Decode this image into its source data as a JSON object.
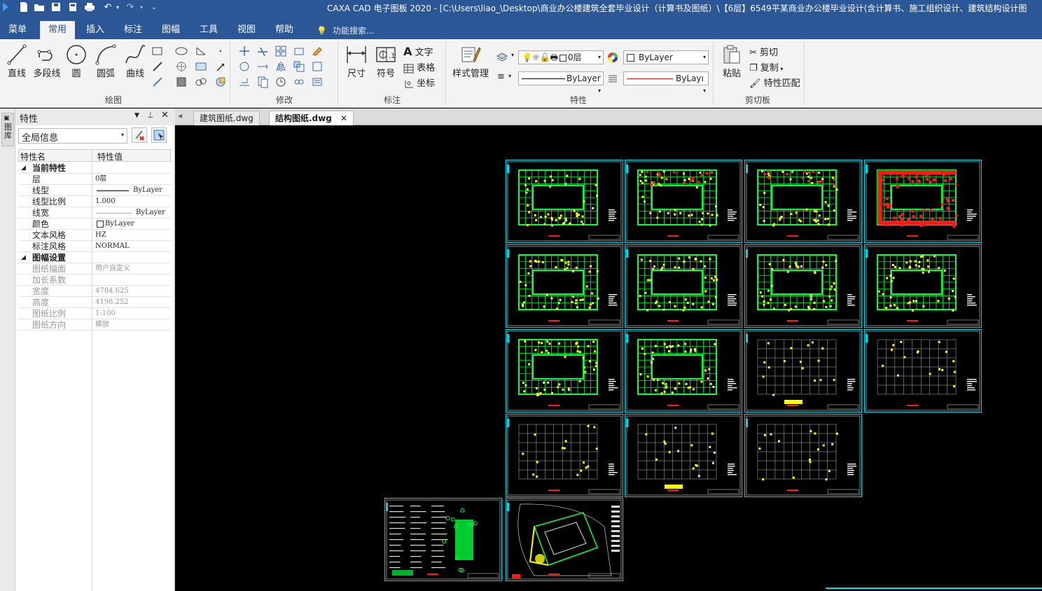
{
  "window": {
    "title": "CAXA CAD 电子图板 2020 - [C:\\Users\\liao_\\Desktop\\商业办公楼建筑全套毕业设计（计算书及图纸）\\【6层】6549平某商业办公楼毕业设计(含计算书、施工组织设计、建筑结构设计图"
  },
  "menubar": {
    "tabs": [
      "菜单",
      "常用",
      "插入",
      "标注",
      "图幅",
      "工具",
      "视图",
      "帮助"
    ],
    "search_placeholder": "功能搜索..."
  },
  "ribbon": {
    "draw": {
      "group_label": "绘图",
      "buttons": [
        "直线",
        "多段线",
        "圆",
        "圆弧",
        "曲线"
      ]
    },
    "modify": {
      "group_label": "修改"
    },
    "annotate": {
      "group_label": "标注",
      "buttons": [
        "尺寸",
        "符号"
      ],
      "text_label": "文字",
      "table_label": "表格",
      "coord_label": "坐标"
    },
    "properties": {
      "group_label": "特性",
      "style_manager": "样式管理",
      "layer_value": "0层",
      "color_value": "ByLayer",
      "linetype_value": "ByLayer",
      "lineweight_value": "ByLayı"
    },
    "clipboard": {
      "group_label": "剪切板",
      "paste": "粘贴",
      "cut": "剪切",
      "copy": "复制",
      "match": "特性匹配"
    }
  },
  "side_tab": {
    "label": "图库"
  },
  "panel": {
    "title": "特性",
    "scope": "全局信息",
    "col_name": "特性名",
    "col_value": "特性值",
    "rows": [
      {
        "k": "当前特性",
        "v": "",
        "type": "grp"
      },
      {
        "k": "层",
        "v": "0层",
        "type": "row"
      },
      {
        "k": "线型",
        "v": "ByLayer",
        "type": "row"
      },
      {
        "k": "线型比例",
        "v": "1.000",
        "type": "row"
      },
      {
        "k": "线宽",
        "v": "ByLayer",
        "type": "row"
      },
      {
        "k": "颜色",
        "v": "ByLayer",
        "type": "row"
      },
      {
        "k": "文本风格",
        "v": "HZ",
        "type": "row"
      },
      {
        "k": "标注风格",
        "v": "NORMAL",
        "type": "row"
      },
      {
        "k": "图幅设置",
        "v": "",
        "type": "grp"
      },
      {
        "k": "图纸幅面",
        "v": "用户自定义",
        "type": "dim"
      },
      {
        "k": "加长系数",
        "v": "",
        "type": "dim"
      },
      {
        "k": "宽度",
        "v": "4784.625",
        "type": "dim"
      },
      {
        "k": "高度",
        "v": "4198.252",
        "type": "dim"
      },
      {
        "k": "图纸比例",
        "v": "1:100",
        "type": "dim"
      },
      {
        "k": "图纸方向",
        "v": "横放",
        "type": "dim"
      }
    ]
  },
  "documents": {
    "tabs": [
      {
        "label": "建筑图纸.dwg",
        "active": false
      },
      {
        "label": "结构图纸.dwg",
        "active": true
      }
    ]
  },
  "drawing": {
    "sheet_count": 18,
    "frame_color": "#00d8e8",
    "accent_green": "#00ff3c",
    "accent_yellow": "#ffff00",
    "accent_red": "#ff1a1a"
  }
}
